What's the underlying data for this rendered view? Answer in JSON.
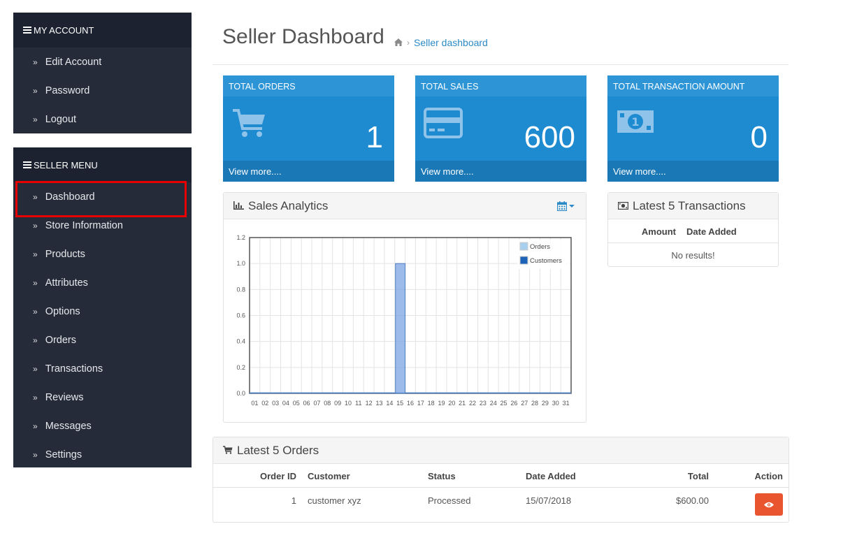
{
  "account_menu": {
    "title": "MY ACCOUNT",
    "items": [
      {
        "label": "Edit Account"
      },
      {
        "label": "Password"
      },
      {
        "label": "Logout"
      }
    ]
  },
  "seller_menu": {
    "title": "SELLER MENU",
    "items": [
      {
        "label": "Dashboard"
      },
      {
        "label": "Store Information"
      },
      {
        "label": "Products"
      },
      {
        "label": "Attributes"
      },
      {
        "label": "Options"
      },
      {
        "label": "Orders"
      },
      {
        "label": "Transactions"
      },
      {
        "label": "Reviews"
      },
      {
        "label": "Messages"
      },
      {
        "label": "Settings"
      }
    ]
  },
  "page": {
    "title": "Seller Dashboard",
    "breadcrumb_home_icon": "home-icon",
    "breadcrumb": "Seller dashboard"
  },
  "tiles": [
    {
      "title": "TOTAL ORDERS",
      "value": "1",
      "footer": "View more....",
      "icon": "cart-icon"
    },
    {
      "title": "TOTAL SALES",
      "value": "600",
      "footer": "View more....",
      "icon": "credit-card-icon"
    },
    {
      "title": "TOTAL TRANSACTION AMOUNT",
      "value": "0",
      "footer": "View more....",
      "icon": "money-icon"
    }
  ],
  "analytics": {
    "title": "Sales Analytics",
    "icon": "bar-chart-icon",
    "calendar_icon": "calendar-icon"
  },
  "chart_data": {
    "type": "bar",
    "categories": [
      "01",
      "02",
      "03",
      "04",
      "05",
      "06",
      "07",
      "08",
      "09",
      "10",
      "11",
      "12",
      "13",
      "14",
      "15",
      "16",
      "17",
      "18",
      "19",
      "20",
      "21",
      "22",
      "23",
      "24",
      "25",
      "26",
      "27",
      "28",
      "29",
      "30",
      "31"
    ],
    "series": [
      {
        "name": "Orders",
        "color": "#a9cfee",
        "values": [
          0,
          0,
          0,
          0,
          0,
          0,
          0,
          0,
          0,
          0,
          0,
          0,
          0,
          0,
          0,
          0,
          0,
          0,
          0,
          0,
          0,
          0,
          0,
          0,
          0,
          0,
          0,
          0,
          0,
          0,
          0
        ]
      },
      {
        "name": "Customers",
        "color": "#1c63b8",
        "values": [
          0,
          0,
          0,
          0,
          0,
          0,
          0,
          0,
          0,
          0,
          0,
          0,
          0,
          0,
          0,
          0,
          0,
          0,
          0,
          0,
          0,
          0,
          0,
          0,
          0,
          0,
          0,
          0,
          0,
          0,
          0
        ]
      }
    ],
    "highlight_bar": {
      "category": "15",
      "value": 1.0,
      "color": "#7ba3e3"
    },
    "yticks": [
      "0.0",
      "0.2",
      "0.4",
      "0.6",
      "0.8",
      "1.0",
      "1.2"
    ],
    "ylim": [
      0,
      1.2
    ],
    "grid": true,
    "legend_position": "top-right"
  },
  "transactions": {
    "title": "Latest 5 Transactions",
    "icon": "money-icon",
    "columns": [
      "Amount",
      "Date Added"
    ],
    "empty": "No results!"
  },
  "orders": {
    "title": "Latest 5 Orders",
    "icon": "cart-icon",
    "columns": [
      "Order ID",
      "Customer",
      "Status",
      "Date Added",
      "Total",
      "Action"
    ],
    "rows": [
      {
        "id": "1",
        "customer": "customer xyz",
        "status": "Processed",
        "date": "15/07/2018",
        "total": "$600.00",
        "action_icon": "eye-icon"
      }
    ]
  },
  "colors": {
    "sidebar": "#252b38",
    "tile": "#1e8bd1",
    "link": "#2b8ac6",
    "action_button": "#e9552e",
    "highlight_border": "#e60000"
  }
}
